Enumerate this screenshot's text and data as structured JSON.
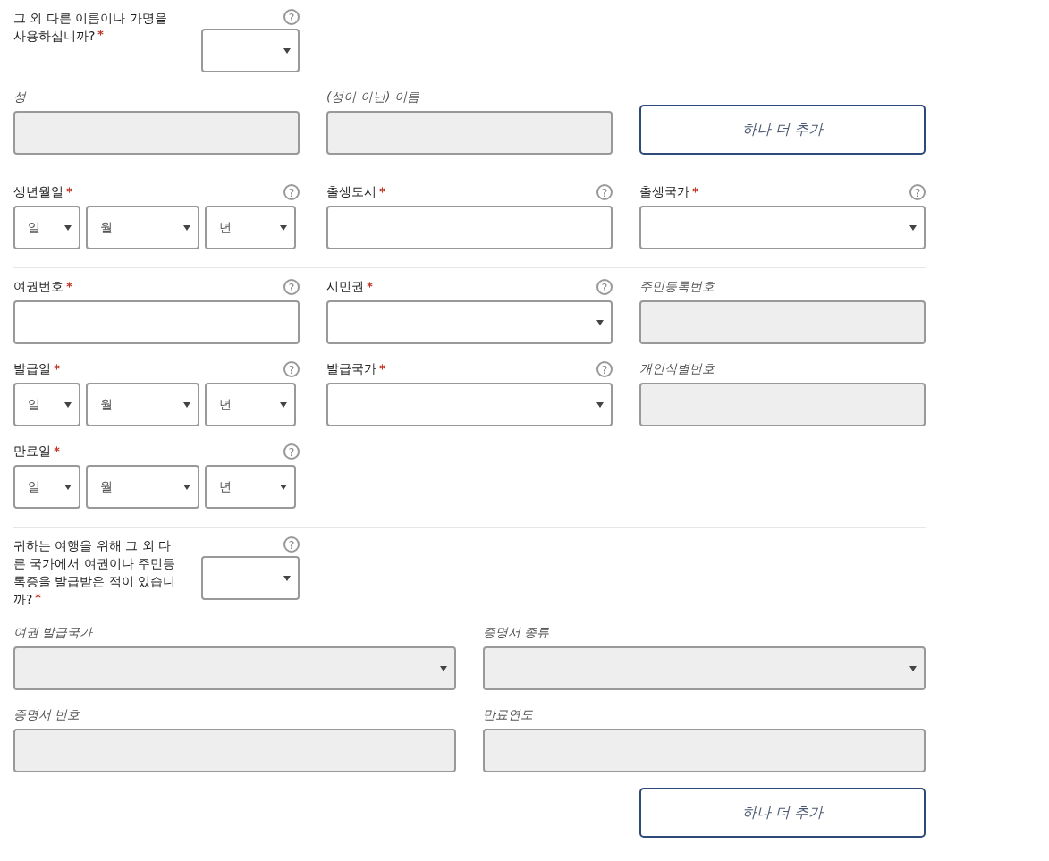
{
  "sections": [
    {
      "rows": [
        {
          "kind": "grid3",
          "fields": [
            {
              "kind": "question",
              "label": "그 외 다른 이름이나 가명을 사용하십니까?",
              "required": true,
              "help": "?",
              "disabled": false
            }
          ]
        },
        {
          "kind": "grid3",
          "fields": [
            {
              "kind": "text",
              "label": "성",
              "required": false,
              "disabled": true
            },
            {
              "kind": "text",
              "label": "(성이 아닌) 이름",
              "required": false,
              "disabled": true
            },
            {
              "kind": "button",
              "label": "하나 더 추가"
            }
          ]
        }
      ]
    },
    {
      "rows": [
        {
          "kind": "grid3",
          "fields": [
            {
              "kind": "date",
              "label": "생년월일",
              "required": true,
              "help": "?",
              "disabled": false,
              "parts": [
                "일",
                "월",
                "년"
              ]
            },
            {
              "kind": "text",
              "label": "출생도시",
              "required": true,
              "help": "?",
              "disabled": false
            },
            {
              "kind": "select",
              "label": "출생국가",
              "required": true,
              "help": "?",
              "disabled": false
            }
          ]
        }
      ]
    },
    {
      "rows": [
        {
          "kind": "grid3",
          "fields": [
            {
              "kind": "text",
              "label": "여권번호",
              "required": true,
              "help": "?",
              "disabled": false
            },
            {
              "kind": "select",
              "label": "시민권",
              "required": true,
              "help": "?",
              "disabled": false
            },
            {
              "kind": "text",
              "label": "주민등록번호",
              "required": false,
              "disabled": true
            }
          ]
        },
        {
          "kind": "grid3",
          "fields": [
            {
              "kind": "date",
              "label": "발급일",
              "required": true,
              "help": "?",
              "disabled": false,
              "parts": [
                "일",
                "월",
                "년"
              ]
            },
            {
              "kind": "select",
              "label": "발급국가",
              "required": true,
              "help": "?",
              "disabled": false
            },
            {
              "kind": "text",
              "label": "개인식별번호",
              "required": false,
              "disabled": true
            }
          ]
        },
        {
          "kind": "grid3",
          "fields": [
            {
              "kind": "date",
              "label": "만료일",
              "required": true,
              "help": "?",
              "disabled": false,
              "parts": [
                "일",
                "월",
                "년"
              ]
            }
          ]
        }
      ]
    },
    {
      "rows": [
        {
          "kind": "grid3",
          "fields": [
            {
              "kind": "question",
              "label": "귀하는 여행을 위해 그 외 다른 국가에서 여권이나 주민등록증을 발급받은 적이 있습니까?",
              "required": true,
              "help": "?",
              "disabled": false
            }
          ]
        },
        {
          "kind": "grid2",
          "fields": [
            {
              "kind": "select",
              "label": "여권 발급국가",
              "required": false,
              "disabled": true
            },
            {
              "kind": "select",
              "label": "증명서 종류",
              "required": false,
              "disabled": true
            }
          ]
        },
        {
          "kind": "grid2",
          "fields": [
            {
              "kind": "text",
              "label": "증명서 번호",
              "required": false,
              "disabled": true
            },
            {
              "kind": "text",
              "label": "만료연도",
              "required": false,
              "disabled": true
            }
          ]
        },
        {
          "kind": "grid3",
          "fields": [
            {
              "kind": "spacer"
            },
            {
              "kind": "spacer"
            },
            {
              "kind": "button",
              "label": "하나 더 추가"
            }
          ]
        }
      ]
    }
  ]
}
